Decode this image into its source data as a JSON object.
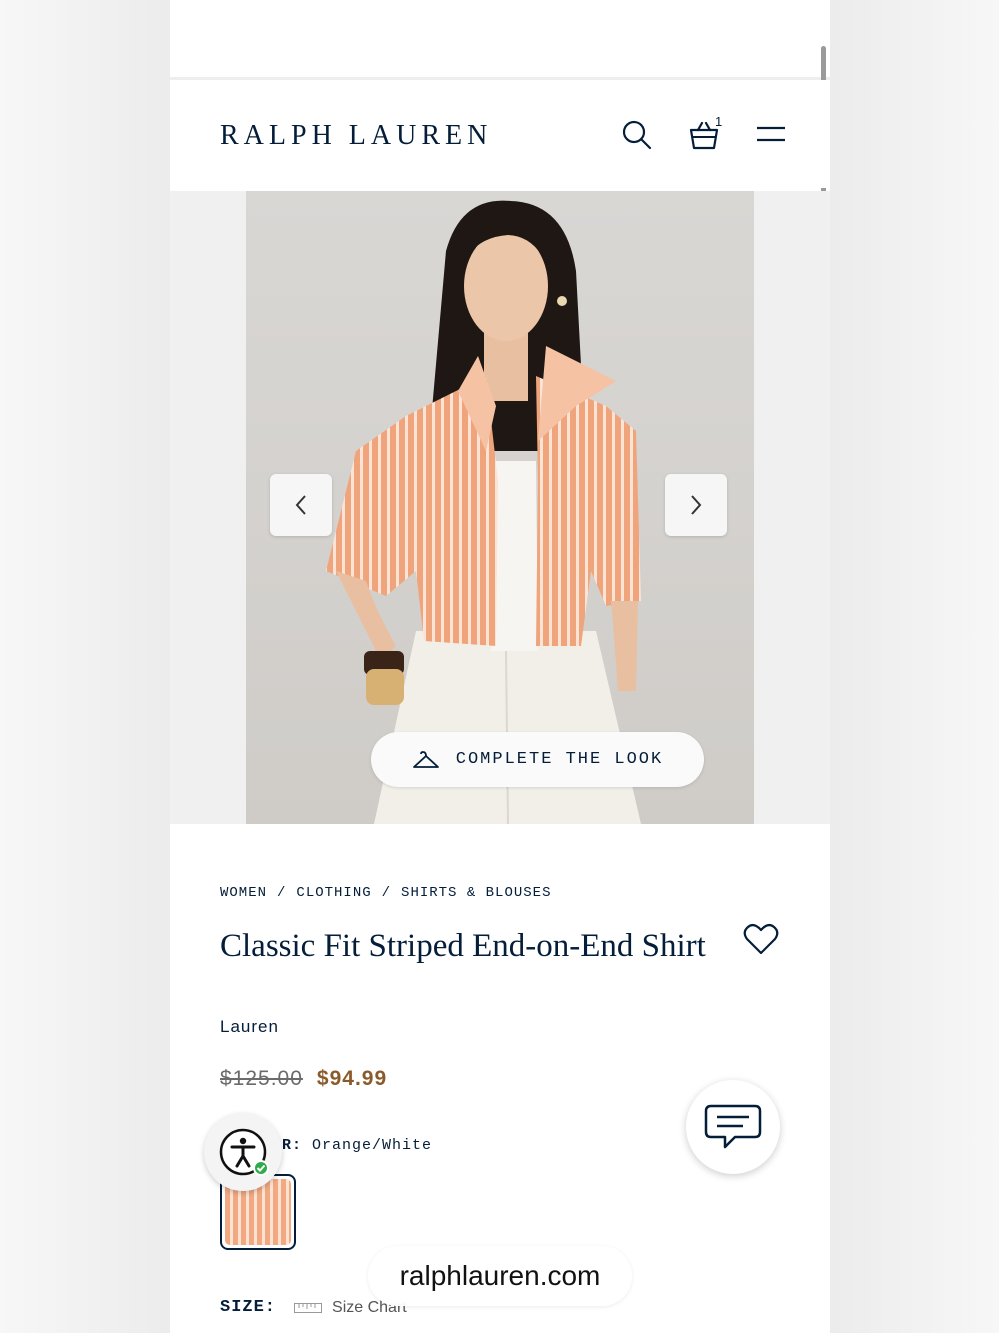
{
  "header": {
    "logo": "RALPH LAUREN",
    "bag_count": "1",
    "icons": [
      "search-icon",
      "shopping-bag-icon",
      "hamburger-menu-icon"
    ]
  },
  "gallery": {
    "complete_the_look": "COMPLETE THE LOOK",
    "icons": [
      "chevron-left-icon",
      "chevron-right-icon",
      "hanger-icon"
    ]
  },
  "product": {
    "breadcrumb": [
      "WOMEN",
      "CLOTHING",
      "SHIRTS & BLOUSES"
    ],
    "breadcrumb_sep": "/",
    "title": "Classic Fit Striped End-on-End Shirt",
    "brand": "Lauren",
    "old_price": "$125.00",
    "sale_price": "$94.99",
    "color_label": "R:",
    "color_value": "Orange/White",
    "size_label": "SIZE:",
    "size_chart": "Size Chart"
  },
  "overlays": {
    "url": "ralphlauren.com"
  },
  "colors": {
    "navy": "#041e3a",
    "sale": "#8a5a2b",
    "swatch_orange": "#f2a880"
  }
}
